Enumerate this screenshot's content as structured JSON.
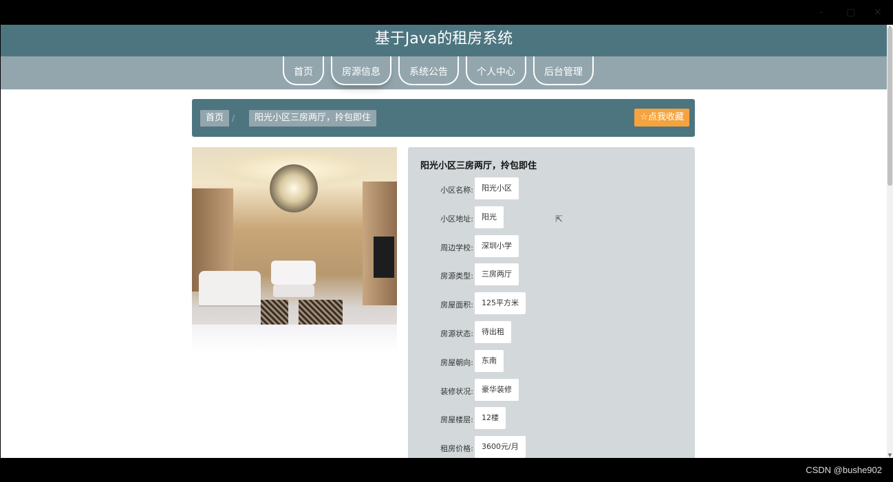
{
  "site": {
    "title": "基于Java的租房系统"
  },
  "nav": {
    "items": [
      {
        "label": "首页"
      },
      {
        "label": "房源信息"
      },
      {
        "label": "系统公告"
      },
      {
        "label": "个人中心"
      },
      {
        "label": "后台管理"
      }
    ],
    "active_index": 1
  },
  "breadcrumb": {
    "home": "首页",
    "separator": "/",
    "current": "阳光小区三房两厅，拎包即住"
  },
  "favorite_button": {
    "label": "☆点我收藏"
  },
  "listing": {
    "title": "阳光小区三房两厅，拎包即住",
    "fields": [
      {
        "label": "小区名称:",
        "value": "阳光小区"
      },
      {
        "label": "小区地址:",
        "value": "阳光"
      },
      {
        "label": "周边学校:",
        "value": "深圳小学"
      },
      {
        "label": "房源类型:",
        "value": "三房两厅"
      },
      {
        "label": "房屋面积:",
        "value": "125平方米"
      },
      {
        "label": "房源状态:",
        "value": "待出租"
      },
      {
        "label": "房屋朝向:",
        "value": "东南"
      },
      {
        "label": "装修状况:",
        "value": "豪华装修"
      },
      {
        "label": "房屋楼层:",
        "value": "12楼"
      },
      {
        "label": "租房价格:",
        "value": "3600元/月"
      }
    ]
  },
  "watermark": "CSDN @bushe902",
  "colors": {
    "header": "#4d7580",
    "nav": "#93a6ad",
    "accent": "#f5a33e",
    "panel": "#d3d8da"
  }
}
